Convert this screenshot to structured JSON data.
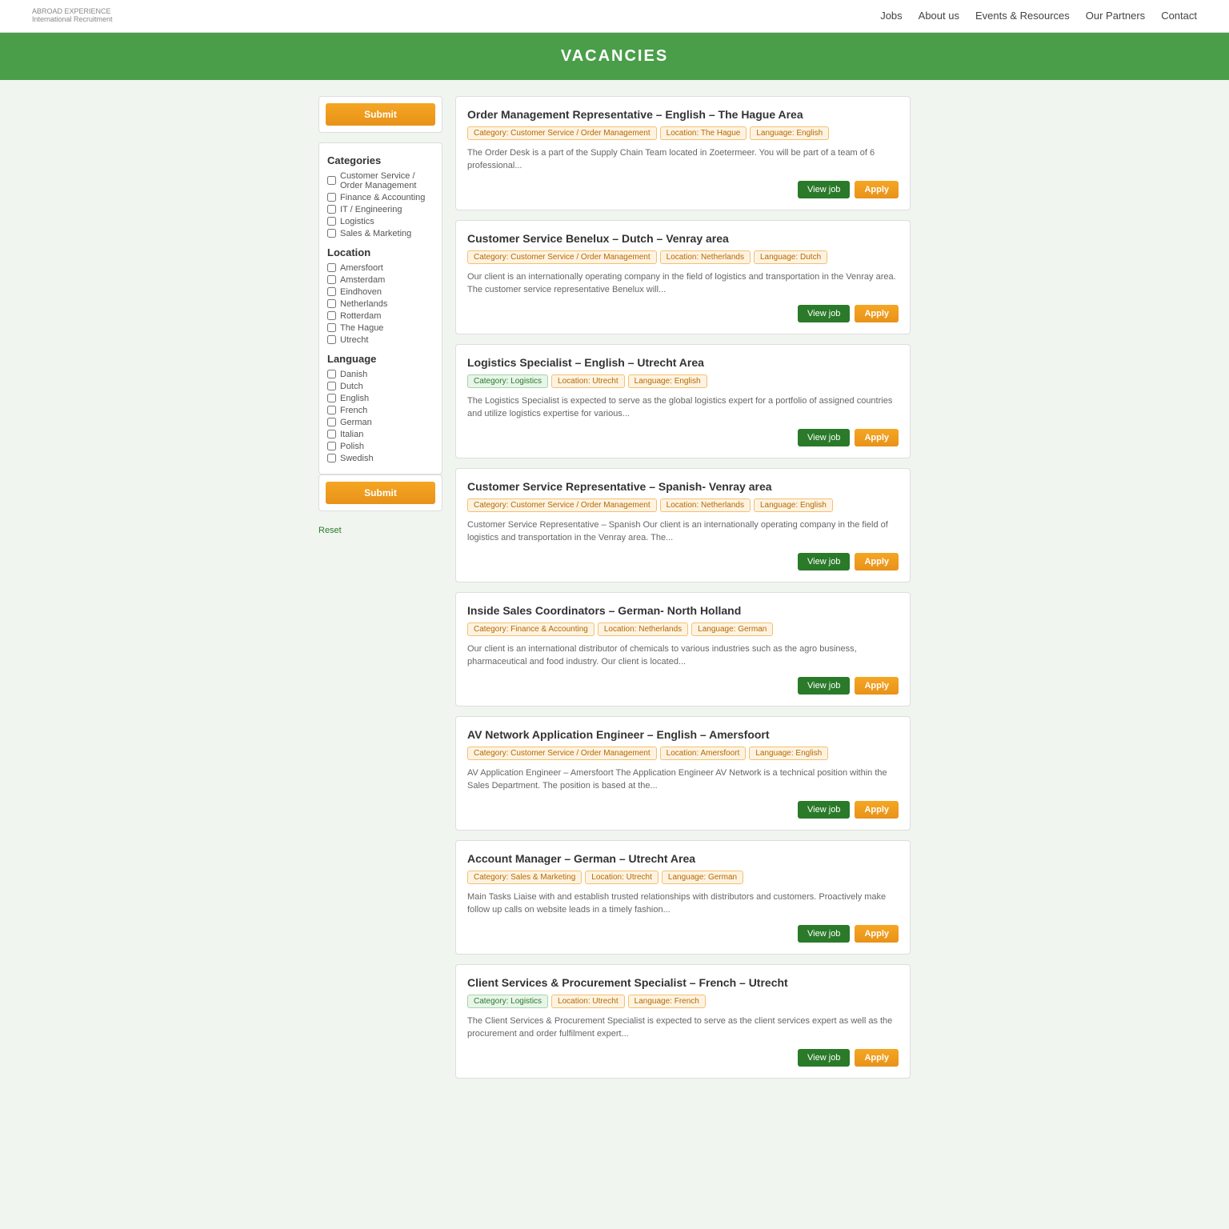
{
  "navbar": {
    "brand": "ABROAD EXPERIENCE",
    "tagline": "International Recruitment",
    "nav_items": [
      "Jobs",
      "About us",
      "Events & Resources",
      "Our Partners",
      "Contact"
    ]
  },
  "page_title": "VACANCIES",
  "sidebar": {
    "submit_label": "Submit",
    "reset_label": "Reset",
    "categories_title": "Categories",
    "categories": [
      "Customer Service / Order Management",
      "Finance & Accounting",
      "IT / Engineering",
      "Logistics",
      "Sales & Marketing"
    ],
    "location_title": "Location",
    "locations": [
      "Amersfoort",
      "Amsterdam",
      "Eindhoven",
      "Netherlands",
      "Rotterdam",
      "The Hague",
      "Utrecht"
    ],
    "language_title": "Language",
    "languages": [
      "Danish",
      "Dutch",
      "English",
      "French",
      "German",
      "Italian",
      "Polish",
      "Swedish"
    ]
  },
  "jobs": [
    {
      "title": "Order Management Representative – English – The Hague Area",
      "tags": [
        {
          "label": "Category: Customer Service / Order Management",
          "type": "orange"
        },
        {
          "label": "Location: The Hague",
          "type": "orange"
        },
        {
          "label": "Language: English",
          "type": "orange"
        }
      ],
      "desc": "The Order Desk is a part of the Supply Chain Team located in Zoetermeer. You will be part of a team of 6 professional...",
      "view_label": "View job",
      "apply_label": "Apply"
    },
    {
      "title": "Customer Service Benelux – Dutch – Venray area",
      "tags": [
        {
          "label": "Category: Customer Service / Order Management",
          "type": "orange"
        },
        {
          "label": "Location: Netherlands",
          "type": "orange"
        },
        {
          "label": "Language: Dutch",
          "type": "orange"
        }
      ],
      "desc": "Our client is an internationally operating company in the field of logistics and transportation in the Venray area. The customer service representative Benelux will...",
      "view_label": "View job",
      "apply_label": "Apply"
    },
    {
      "title": "Logistics Specialist – English – Utrecht Area",
      "tags": [
        {
          "label": "Category: Logistics",
          "type": "green"
        },
        {
          "label": "Location: Utrecht",
          "type": "orange"
        },
        {
          "label": "Language: English",
          "type": "orange"
        }
      ],
      "desc": "The Logistics Specialist is expected to serve as the global logistics expert for a portfolio of assigned countries and utilize logistics expertise for various...",
      "view_label": "View job",
      "apply_label": "Apply"
    },
    {
      "title": "Customer Service Representative – Spanish- Venray area",
      "tags": [
        {
          "label": "Category: Customer Service / Order Management",
          "type": "orange"
        },
        {
          "label": "Location: Netherlands",
          "type": "orange"
        },
        {
          "label": "Language: English",
          "type": "orange"
        }
      ],
      "desc": "Customer Service Representative – Spanish Our client is an internationally operating company in the field of logistics and transportation in the Venray area. The...",
      "view_label": "View job",
      "apply_label": "Apply"
    },
    {
      "title": "Inside Sales Coordinators – German- North Holland",
      "tags": [
        {
          "label": "Category: Finance & Accounting",
          "type": "orange"
        },
        {
          "label": "Location: Netherlands",
          "type": "orange"
        },
        {
          "label": "Language: German",
          "type": "orange"
        }
      ],
      "desc": "Our client is an international distributor of chemicals to various industries such as the agro business, pharmaceutical and food industry. Our client is located...",
      "view_label": "View job",
      "apply_label": "Apply"
    },
    {
      "title": "AV Network Application Engineer – English – Amersfoort",
      "tags": [
        {
          "label": "Category: Customer Service / Order Management",
          "type": "orange"
        },
        {
          "label": "Location: Amersfoort",
          "type": "orange"
        },
        {
          "label": "Language: English",
          "type": "orange"
        }
      ],
      "desc": "AV Application Engineer – Amersfoort The Application Engineer AV Network is a technical position within the Sales Department. The position is based at the...",
      "view_label": "View job",
      "apply_label": "Apply"
    },
    {
      "title": "Account Manager – German – Utrecht Area",
      "tags": [
        {
          "label": "Category: Sales & Marketing",
          "type": "orange"
        },
        {
          "label": "Location: Utrecht",
          "type": "orange"
        },
        {
          "label": "Language: German",
          "type": "orange"
        }
      ],
      "desc": "Main Tasks Liaise with and establish trusted relationships with distributors and customers. Proactively make follow up calls on website leads in a timely fashion...",
      "view_label": "View job",
      "apply_label": "Apply"
    },
    {
      "title": "Client Services & Procurement Specialist – French – Utrecht",
      "tags": [
        {
          "label": "Category: Logistics",
          "type": "green"
        },
        {
          "label": "Location: Utrecht",
          "type": "orange"
        },
        {
          "label": "Language: French",
          "type": "orange"
        }
      ],
      "desc": "The Client Services & Procurement Specialist is expected to serve as the client services expert as well as the procurement and order fulfilment expert...",
      "view_label": "View job",
      "apply_label": "Apply"
    }
  ]
}
